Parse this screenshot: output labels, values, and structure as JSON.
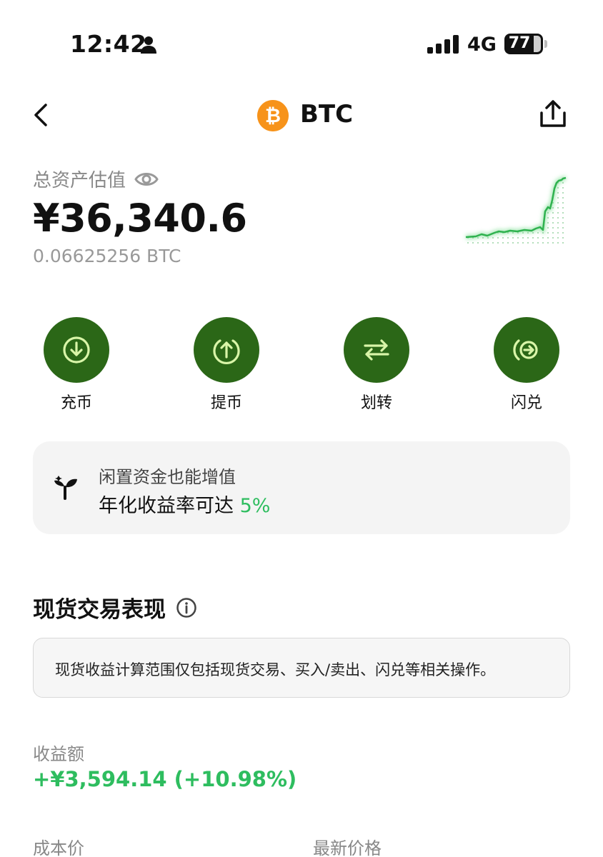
{
  "status_bar": {
    "time": "12:42",
    "network": "4G",
    "battery": "77"
  },
  "header": {
    "title": "BTC",
    "logo_symbol": "₿",
    "logo_color": "#f7931a"
  },
  "assets": {
    "label": "总资产估值",
    "value": "¥36,340.6",
    "btc_amount": "0.06625256 BTC"
  },
  "actions": [
    {
      "label": "充币",
      "icon": "deposit-icon"
    },
    {
      "label": "提币",
      "icon": "withdraw-icon"
    },
    {
      "label": "划转",
      "icon": "transfer-icon"
    },
    {
      "label": "闪兑",
      "icon": "convert-icon"
    }
  ],
  "earn_banner": {
    "title": "闲置资金也能增值",
    "line_prefix": "年化收益率可达",
    "rate": "5%"
  },
  "spot_performance": {
    "title": "现货交易表现",
    "note": "现货收益计算范围仅包括现货交易、买入/卖出、闪兑等相关操作。",
    "pnl_label": "收益额",
    "pnl_value": "+¥3,594.14 (+10.98%)",
    "cost_label": "成本价",
    "latest_label": "最新价格"
  },
  "colors": {
    "accent_green": "#2ebd5f",
    "action_button": "#2b6717",
    "action_icon": "#d9f5a8"
  }
}
